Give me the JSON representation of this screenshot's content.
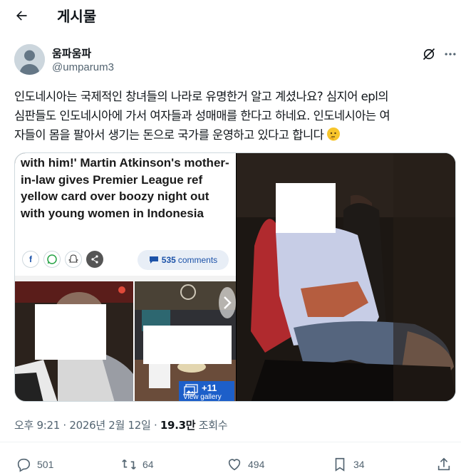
{
  "header": {
    "title": "게시물",
    "back_icon": "arrow-left-icon"
  },
  "author": {
    "display_name": "움파움파",
    "handle": "@umparum3",
    "avatar": "default-avatar-icon"
  },
  "tweet": {
    "text_line1": "인도네시아는 국제적인 창녀들의 나라로 유명한거 알고 계셨나요? 심지어 epl의",
    "text_line2": "심판들도 인도네시아에 가서 여자들과 성매매를 한다고 하네요. 인도네시아는 여",
    "text_line3": "자들이 몸을 팔아서 생기는 돈으로 국가를 운영하고 있다고 합니다",
    "emoji": "thinking-face-emoji"
  },
  "media": {
    "headline": "with him!' Martin Atkinson's mother-in-law gives Premier League ref yellow card over boozy night out with young women in Indonesia",
    "share_labels": {
      "facebook": "f"
    },
    "comments_count": "535",
    "comments_label": "comments",
    "gallery_count": "+11",
    "gallery_label": "View gallery"
  },
  "meta": {
    "time": "오후 9:21",
    "date": "2026년 2월 12일",
    "views": "19.3만",
    "views_label": "조회수",
    "separator": "·"
  },
  "actions": {
    "replies": "501",
    "reposts": "64",
    "likes": "494",
    "bookmarks": "34"
  },
  "colors": {
    "text": "#0f1419",
    "secondary": "#536471",
    "border": "#cfd9de",
    "link": "#1c52a8"
  }
}
